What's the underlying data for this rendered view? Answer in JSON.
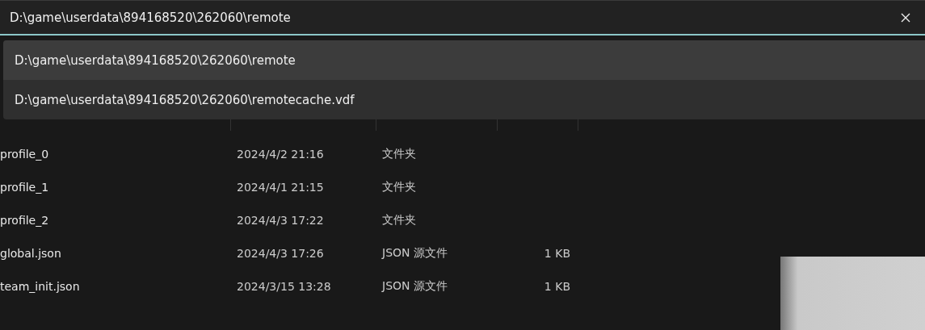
{
  "address_bar": {
    "value": "D:\\game\\userdata\\894168520\\262060\\remote"
  },
  "suggestions": [
    {
      "label": "D:\\game\\userdata\\894168520\\262060\\remote",
      "selected": true
    },
    {
      "label": "D:\\game\\userdata\\894168520\\262060\\remotecache.vdf",
      "selected": false
    }
  ],
  "files": [
    {
      "name": "profile_0",
      "date": "2024/4/2 21:16",
      "type": "文件夹"
    },
    {
      "name": "profile_1",
      "date": "2024/4/1 21:15",
      "type": "文件夹"
    },
    {
      "name": "profile_2",
      "date": "2024/4/3 17:22",
      "type": "文件夹"
    },
    {
      "name": "global.json",
      "date": "2024/4/3 17:26",
      "type": "JSON 源文件",
      "size": "1 KB"
    },
    {
      "name": "team_init.json",
      "date": "2024/3/15 13:28",
      "type": "JSON 源文件",
      "size": "1 KB"
    }
  ]
}
